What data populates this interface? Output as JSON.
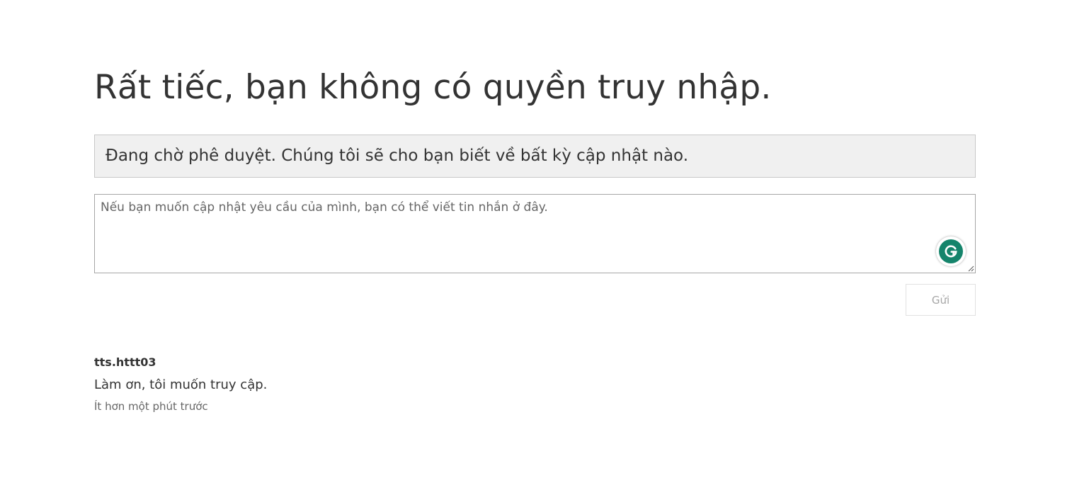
{
  "page": {
    "title": "Rất tiếc, bạn không có quyền truy nhập."
  },
  "status": {
    "text": "Đang chờ phê duyệt. Chúng tôi sẽ cho bạn biết về bất kỳ cập nhật nào."
  },
  "message_box": {
    "placeholder": "Nếu bạn muốn cập nhật yêu cầu của mình, bạn có thể viết tin nhắn ở đây.",
    "value": "",
    "extension_icon": "grammarly-icon"
  },
  "actions": {
    "send_label": "Gửi"
  },
  "request": {
    "author": "tts.httt03",
    "message": "Làm ơn, tôi muốn truy cập.",
    "time": "Ít hơn một phút trước"
  },
  "colors": {
    "banner_background": "#f0f0f0",
    "grammarly_green": "#15846b",
    "disabled_text": "#a6a6a6"
  }
}
